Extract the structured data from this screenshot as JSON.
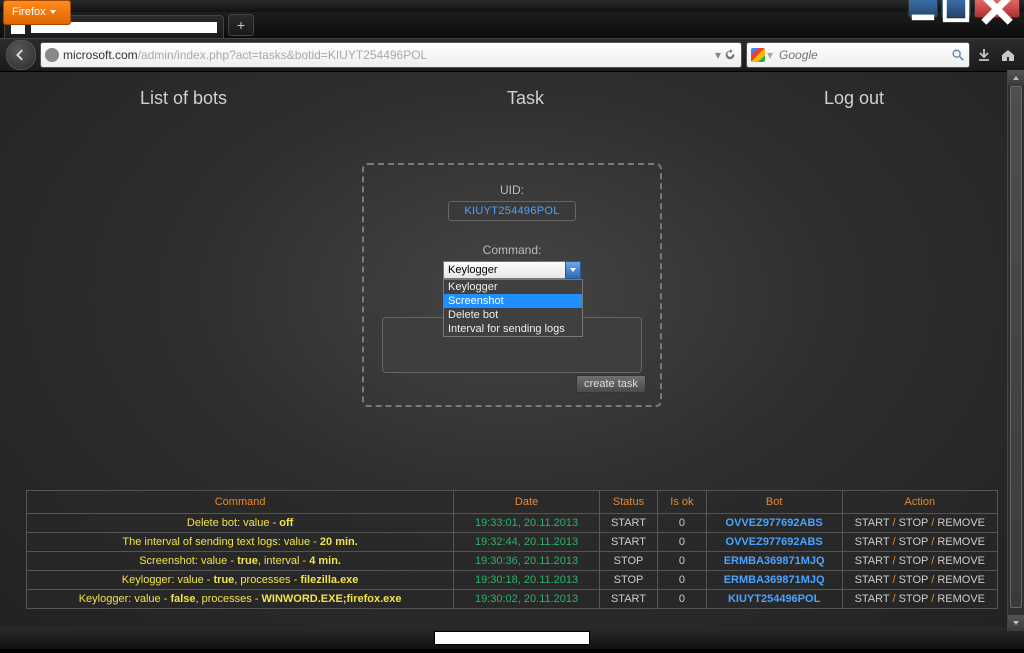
{
  "browser": {
    "menu_label": "Firefox"
  },
  "url": {
    "host": "microsoft.com",
    "path": "/admin/index.php?act=tasks&botid=KIUYT254496POL"
  },
  "search": {
    "placeholder": "Google"
  },
  "nav": {
    "bots": "List of bots",
    "task": "Task",
    "logout": "Log out"
  },
  "form": {
    "uid_label": "UID:",
    "uid_value": "KIUYT254496POL",
    "cmd_label": "Command:",
    "cmd_selected": "Keylogger",
    "options": [
      "Keylogger",
      "Screenshot",
      "Delete bot",
      "Interval for sending logs"
    ],
    "create_btn": "create task"
  },
  "table": {
    "headers": {
      "command": "Command",
      "date": "Date",
      "status": "Status",
      "isok": "Is ok",
      "bot": "Bot",
      "action": "Action"
    },
    "action_labels": {
      "start": "START",
      "stop": "STOP",
      "remove": "REMOVE"
    },
    "rows": [
      {
        "cmd_html": "Delete bot: value - <b>off</b>",
        "date": "19:33:01, 20.11.2013",
        "status": "START",
        "isok": "0",
        "bot": "OVVEZ977692ABS"
      },
      {
        "cmd_html": "The interval of sending text logs: value - <b>20 min.</b>",
        "date": "19:32:44, 20.11.2013",
        "status": "START",
        "isok": "0",
        "bot": "OVVEZ977692ABS"
      },
      {
        "cmd_html": "Screenshot: value - <b>true</b>, interval - <b>4 min.</b>",
        "date": "19:30:36, 20.11.2013",
        "status": "STOP",
        "isok": "0",
        "bot": "ERMBA369871MJQ"
      },
      {
        "cmd_html": "Keylogger: value - <b>true</b>, processes - <b>filezilla.exe</b>",
        "date": "19:30:18, 20.11.2013",
        "status": "STOP",
        "isok": "0",
        "bot": "ERMBA369871MJQ"
      },
      {
        "cmd_html": "Keylogger: value - <b>false</b>, processes - <b>WINWORD.EXE;firefox.exe</b>",
        "date": "19:30:02, 20.11.2013",
        "status": "START",
        "isok": "0",
        "bot": "KIUYT254496POL"
      }
    ]
  }
}
